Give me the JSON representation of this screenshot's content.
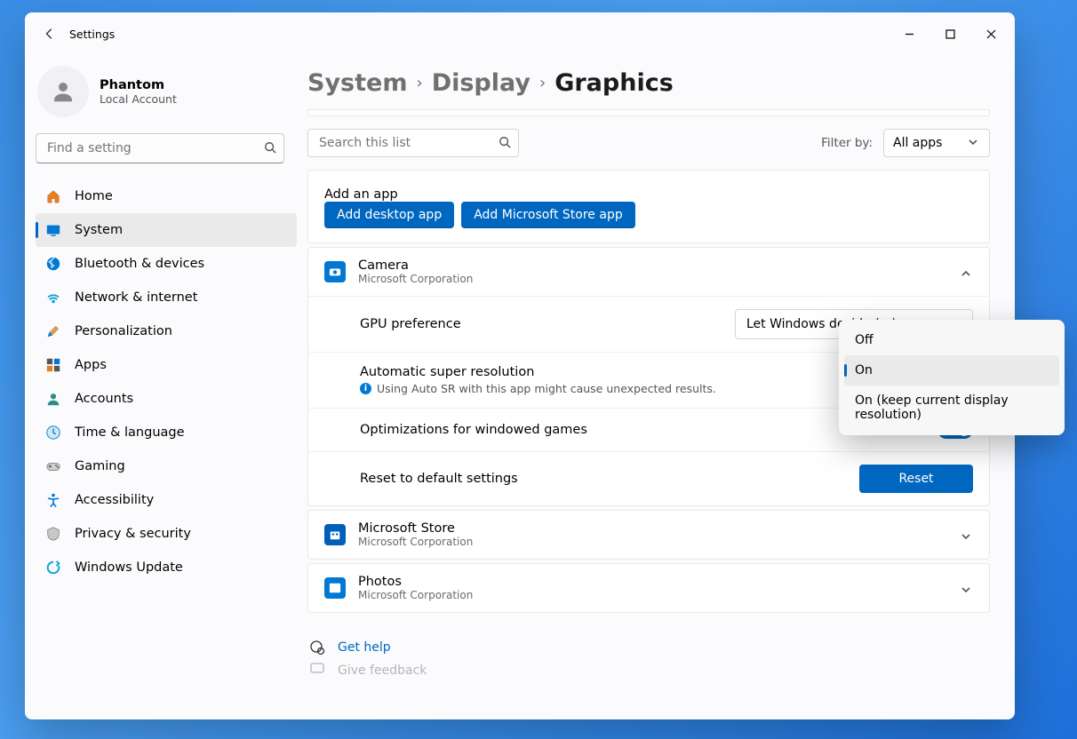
{
  "window_title": "Settings",
  "user": {
    "name": "Phantom",
    "subtitle": "Local Account"
  },
  "sidebar_search_placeholder": "Find a setting",
  "nav": [
    {
      "id": "home",
      "label": "Home"
    },
    {
      "id": "system",
      "label": "System"
    },
    {
      "id": "bluetooth",
      "label": "Bluetooth & devices"
    },
    {
      "id": "network",
      "label": "Network & internet"
    },
    {
      "id": "personalization",
      "label": "Personalization"
    },
    {
      "id": "apps",
      "label": "Apps"
    },
    {
      "id": "accounts",
      "label": "Accounts"
    },
    {
      "id": "time",
      "label": "Time & language"
    },
    {
      "id": "gaming",
      "label": "Gaming"
    },
    {
      "id": "accessibility",
      "label": "Accessibility"
    },
    {
      "id": "privacy",
      "label": "Privacy & security"
    },
    {
      "id": "update",
      "label": "Windows Update"
    }
  ],
  "nav_active": "system",
  "breadcrumb": {
    "l1": "System",
    "l2": "Display",
    "l3": "Graphics"
  },
  "list_search_placeholder": "Search this list",
  "filter_label": "Filter by:",
  "filter_value": "All apps",
  "add_app": {
    "title": "Add an app",
    "desktop_btn": "Add desktop app",
    "store_btn": "Add Microsoft Store app"
  },
  "apps": {
    "camera": {
      "name": "Camera",
      "publisher": "Microsoft Corporation",
      "gpu_pref_label": "GPU preference",
      "gpu_pref_value": "Let Windows decide (…)",
      "asr_label": "Automatic super resolution",
      "asr_info": "Using Auto SR with this app might cause unexpected results.",
      "owg_label": "Optimizations for windowed games",
      "owg_value": "On",
      "reset_label": "Reset to default settings",
      "reset_btn": "Reset"
    },
    "store": {
      "name": "Microsoft Store",
      "publisher": "Microsoft Corporation"
    },
    "photos": {
      "name": "Photos",
      "publisher": "Microsoft Corporation"
    }
  },
  "dropdown_menu": {
    "options": [
      "Off",
      "On",
      "On (keep current display resolution)"
    ],
    "selected": "On"
  },
  "help_link": "Get help",
  "feedback_link": "Give feedback",
  "colors": {
    "accent": "#0067c0"
  }
}
